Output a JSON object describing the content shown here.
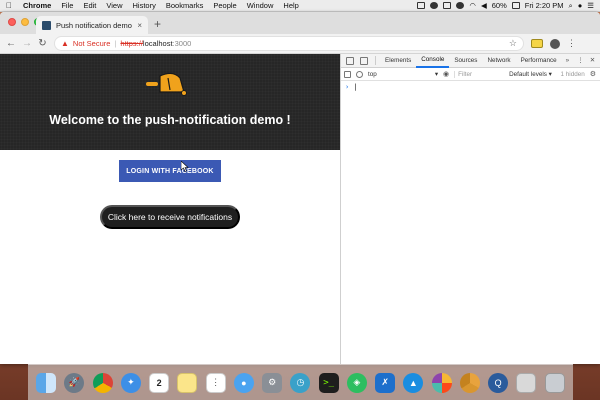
{
  "menubar": {
    "app_name": "Chrome",
    "items": [
      "File",
      "Edit",
      "View",
      "History",
      "Bookmarks",
      "People",
      "Window",
      "Help"
    ],
    "battery": "60%",
    "clock": "Fri 2:20 PM"
  },
  "browser": {
    "tab_title": "Push notification demo",
    "new_tab": "+",
    "tab_close": "×",
    "security_label": "Not Secure",
    "url_scheme": "https://",
    "url_host": "localhost",
    "url_port": ":3000"
  },
  "page": {
    "hero_title": "Welcome to the push-notification demo !",
    "facebook_button": "LOGIN WITH FACEBOOK",
    "notify_button": "Click here to receive notifications"
  },
  "devtools": {
    "tabs": [
      "Elements",
      "Console",
      "Sources",
      "Network",
      "Performance"
    ],
    "active_tab": "Console",
    "more": "»",
    "context": "top",
    "filter_placeholder": "Filter",
    "levels": "Default levels ▾",
    "hidden_count": "1 hidden",
    "prompt": "›"
  },
  "dock": {
    "apps": [
      "finder-icon",
      "launchpad-icon",
      "chrome-icon",
      "safari-icon",
      "calendar-icon",
      "notes-icon",
      "reminders-icon",
      "messages-icon",
      "system-preferences-icon",
      "time-machine-icon",
      "terminal-icon",
      "evernote-icon",
      "xcode-icon",
      "testflight-icon",
      "photos-icon",
      "chrome-canary-icon",
      "quicktime-icon",
      "printer-icon",
      "trash-icon"
    ],
    "calendar_day": "2"
  },
  "colors": {
    "facebook_blue": "#3b59b4",
    "hero_bg": "#262626",
    "bell": "#f0a21c",
    "insecure_red": "#d93025"
  }
}
